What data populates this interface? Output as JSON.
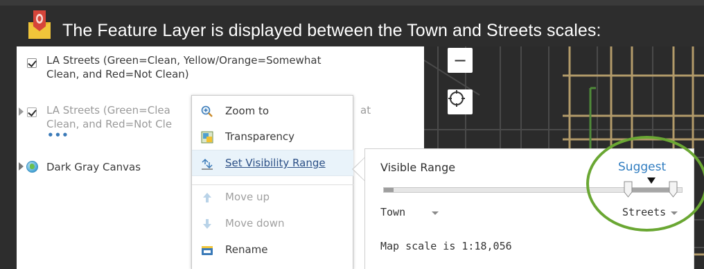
{
  "header": {
    "text": "The Feature Layer is displayed between the Town and Streets scales:"
  },
  "layers": [
    {
      "label_line1": "LA Streets (Green=Clean, Yellow/Orange=Somewhat",
      "label_line2": "Clean, and Red=Not Clean)",
      "checked": true
    },
    {
      "label_line1": "LA Streets (Green=Clea",
      "label_line1_tail": "at",
      "label_line2": "Clean, and Red=Not Cle",
      "checked": true,
      "more": "•••"
    },
    {
      "label": "Dark Gray Canvas"
    }
  ],
  "map_controls": {
    "zoom_out": "−",
    "locate_icon": "locate-icon"
  },
  "context_menu": {
    "items": [
      {
        "label": "Zoom to",
        "icon": "zoom-to-icon",
        "enabled": true
      },
      {
        "label": "Transparency",
        "icon": "transparency-icon",
        "enabled": true
      },
      {
        "label": "Set Visibility Range",
        "icon": "visibility-range-icon",
        "enabled": true,
        "selected": true
      },
      {
        "label": "Move up",
        "icon": "arrow-up-icon",
        "enabled": false
      },
      {
        "label": "Move down",
        "icon": "arrow-down-icon",
        "enabled": false
      },
      {
        "label": "Rename",
        "icon": "rename-icon",
        "enabled": true
      }
    ]
  },
  "visibility_popup": {
    "title": "Visible Range",
    "suggest": "Suggest",
    "min_scale": "Town",
    "max_scale": "Streets",
    "map_scale": "Map scale is 1:18,056"
  },
  "colors": {
    "highlight_ring": "#6aa733",
    "link": "#2f7cc0",
    "header_text": "#ffffff",
    "background": "#2d2d2d"
  }
}
